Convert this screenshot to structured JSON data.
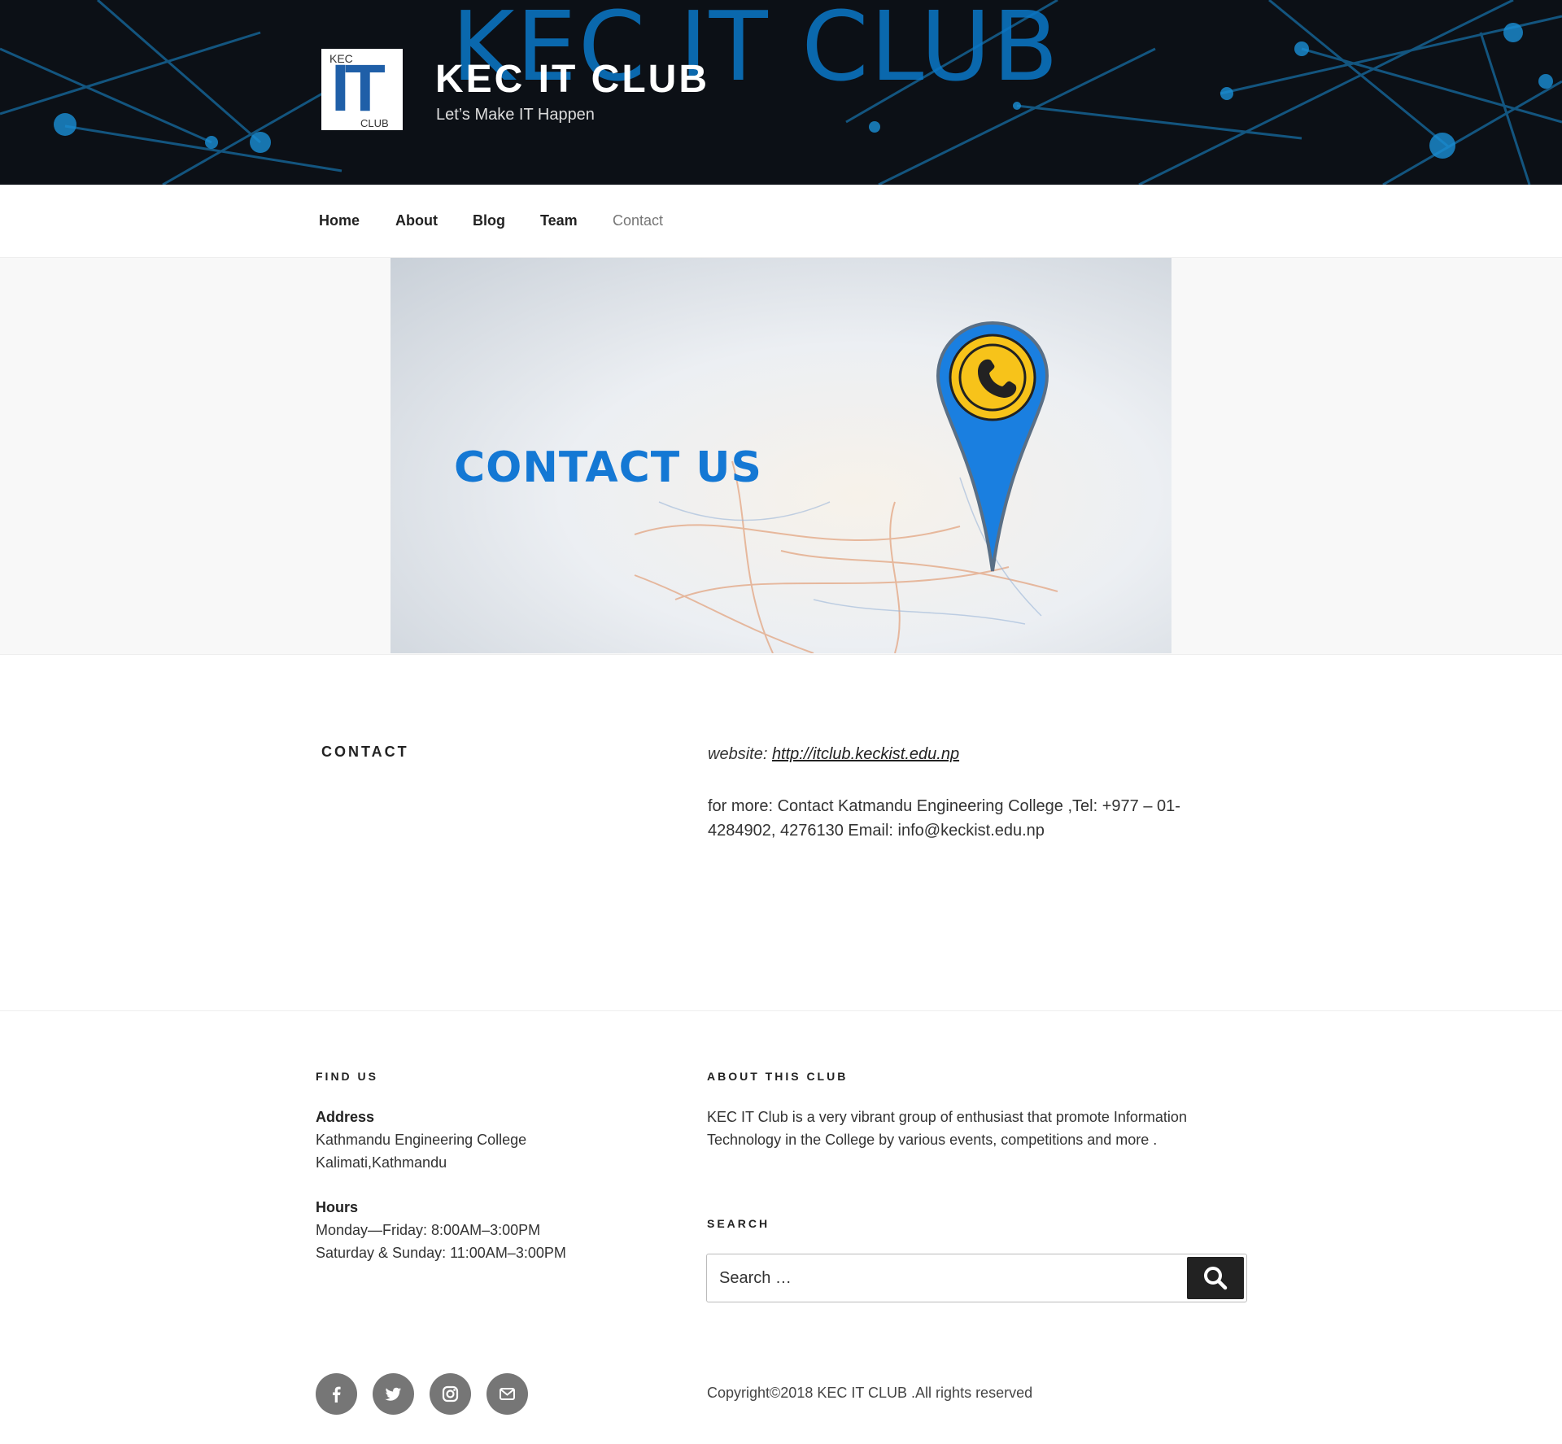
{
  "header": {
    "watermark": "KEC IT CLUB",
    "logo": {
      "top": "KEC",
      "main": "IT",
      "bottom": "CLUB"
    },
    "title": "KEC IT CLUB",
    "tagline": "Let’s Make IT Happen"
  },
  "nav": {
    "items": [
      {
        "label": "Home",
        "current": false
      },
      {
        "label": "About",
        "current": false
      },
      {
        "label": "Blog",
        "current": false
      },
      {
        "label": "Team",
        "current": false
      },
      {
        "label": "Contact",
        "current": true
      }
    ]
  },
  "hero": {
    "text": "CONTACT US",
    "pin_icon": "phone-pin-icon",
    "accent": "#1478d4",
    "pin_yellow": "#f7c31a"
  },
  "content": {
    "heading": "CONTACT",
    "website_label": "website:",
    "website_url": "http://itclub.keckist.edu.np",
    "more": "for more: Contact Katmandu Engineering College ,Tel: +977 – 01-4284902, 4276130 Email: info@keckist.edu.np"
  },
  "footer": {
    "find_us": {
      "title": "FIND US",
      "address_label": "Address",
      "address_line1": "Kathmandu Engineering College",
      "address_line2": "Kalimati,Kathmandu",
      "hours_label": "Hours",
      "hours_line1": "Monday—Friday: 8:00AM–3:00PM",
      "hours_line2": "Saturday & Sunday: 11:00AM–3:00PM"
    },
    "about": {
      "title": "ABOUT THIS CLUB",
      "text": "KEC IT Club is a very vibrant group of enthusiast that promote Information Technology in the College by various events, competitions and more ."
    },
    "search": {
      "title": "SEARCH",
      "placeholder": "Search …",
      "button_icon": "search-icon"
    },
    "social": [
      "facebook-icon",
      "twitter-icon",
      "instagram-icon",
      "email-icon"
    ],
    "copyright": "Copyright©2018 KEC IT CLUB .All rights reserved"
  }
}
